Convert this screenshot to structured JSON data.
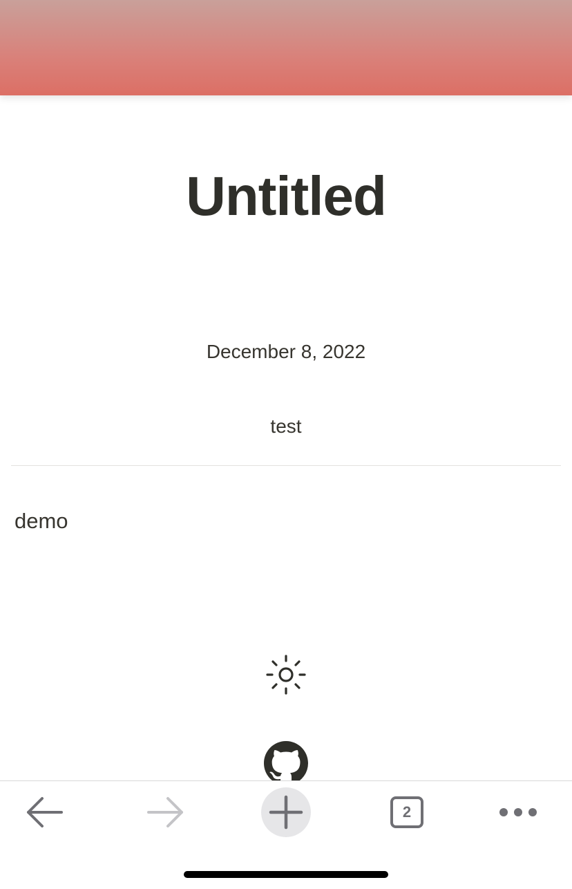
{
  "page": {
    "title": "Untitled",
    "date": "December 8, 2022",
    "tag": "test",
    "body": "demo"
  },
  "cover": {
    "gradient_top": "#c9a09a",
    "gradient_bottom": "#dc6f65"
  },
  "footer": {
    "theme_icon": "sun-icon",
    "github_icon": "github-icon"
  },
  "browser_toolbar": {
    "back_icon": "back-arrow-icon",
    "forward_icon": "forward-arrow-icon",
    "new_tab_icon": "plus-icon",
    "tab_count": "2",
    "more_icon": "more-dots-icon"
  }
}
